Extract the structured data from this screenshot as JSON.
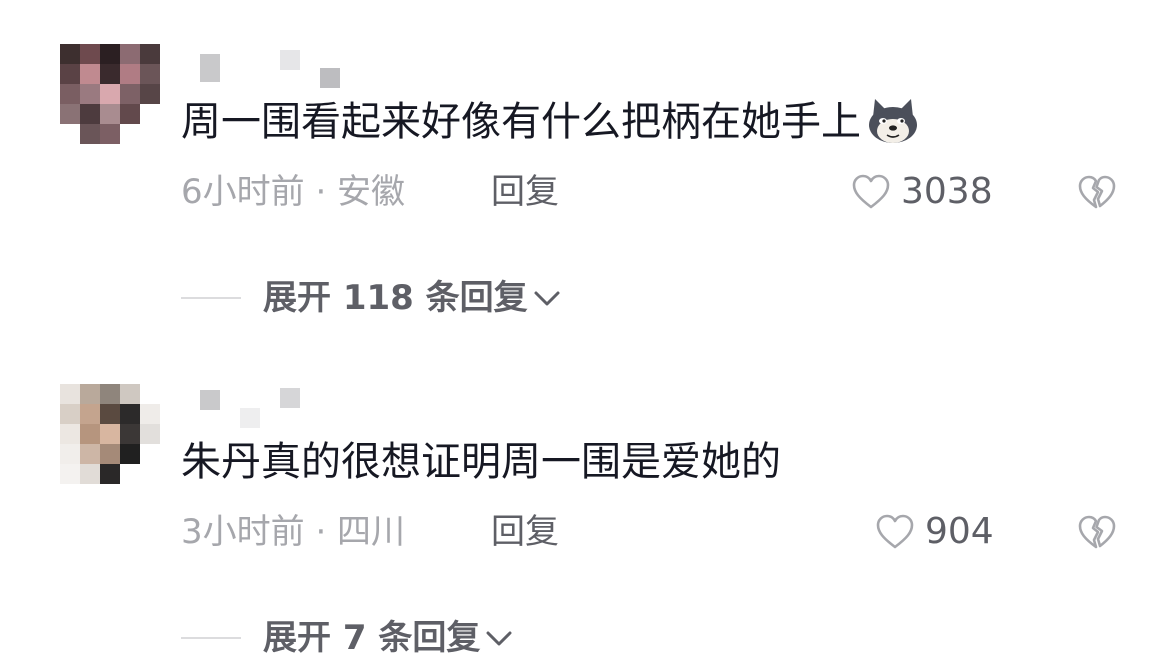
{
  "comments": [
    {
      "text": "周一围看起来好像有什么把柄在她手上",
      "emoji": "doge-emoji",
      "time_location": "6小时前 · 安徽",
      "reply_label": "回复",
      "likes": "3038",
      "expand_label": "展开 118 条回复"
    },
    {
      "text": "朱丹真的很想证明周一围是爱她的",
      "time_location": "3小时前 · 四川",
      "reply_label": "回复",
      "likes": "904",
      "expand_label": "展开 7 条回复"
    }
  ],
  "icons": {
    "like": "heart-outline-icon",
    "dislike": "broken-heart-icon",
    "expand": "chevron-down-icon"
  },
  "colors": {
    "text_primary": "#161823",
    "text_secondary": "#a6a7ac",
    "action_text": "#5e5f66"
  }
}
